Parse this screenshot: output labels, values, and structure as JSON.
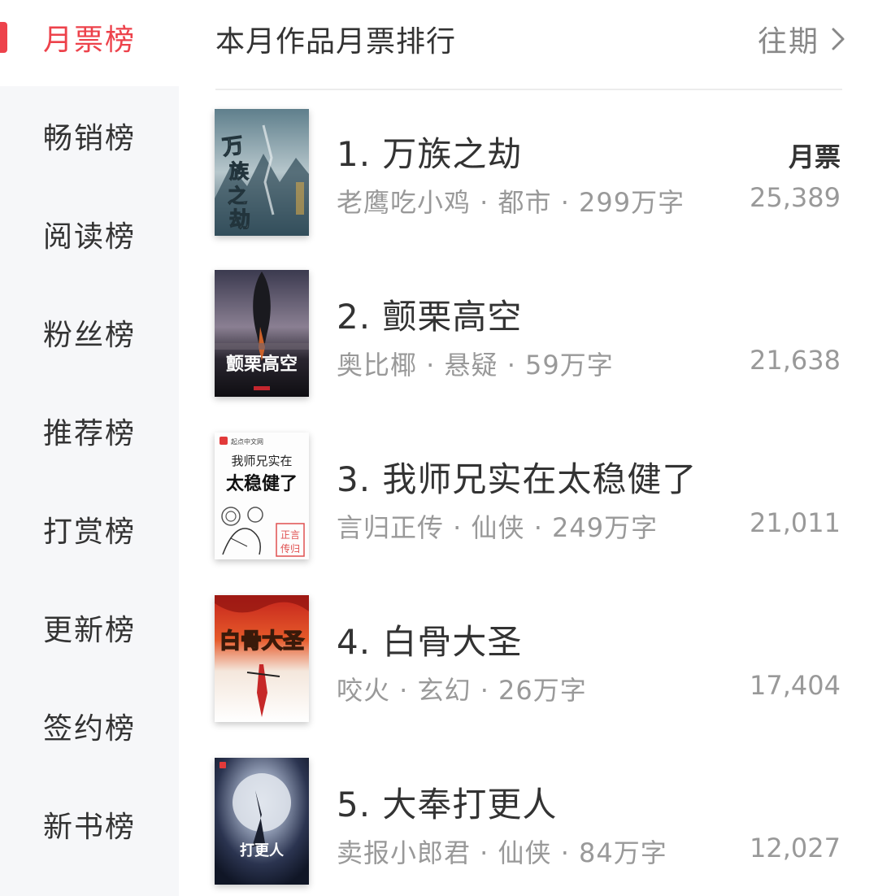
{
  "sidebar": {
    "items": [
      {
        "label": "月票榜",
        "active": true
      },
      {
        "label": "畅销榜"
      },
      {
        "label": "阅读榜"
      },
      {
        "label": "粉丝榜"
      },
      {
        "label": "推荐榜"
      },
      {
        "label": "打赏榜"
      },
      {
        "label": "更新榜"
      },
      {
        "label": "签约榜"
      },
      {
        "label": "新书榜"
      }
    ],
    "accent_color": "#ed424b"
  },
  "header": {
    "title": "本月作品月票排行",
    "history_label": "往期",
    "history_icon": "chevron-right-icon"
  },
  "list": {
    "votes_label": "月票",
    "books": [
      {
        "title": "1. 万族之劫",
        "meta": "老鹰吃小鸡 · 都市 · 299万字",
        "votes": "25,389",
        "cover_text": "万族之劫"
      },
      {
        "title": "2. 颤栗高空",
        "meta": "奥比椰 · 悬疑 · 59万字",
        "votes": "21,638",
        "cover_text": "颤栗高空"
      },
      {
        "title": "3. 我师兄实在太稳健了",
        "meta": "言归正传 · 仙侠 · 249万字",
        "votes": "21,011",
        "cover_text_top": "我师兄实在",
        "cover_text_main": "太稳健了",
        "cover_brand": "起点中文网"
      },
      {
        "title": "4. 白骨大圣",
        "meta": "咬火 · 玄幻 · 26万字",
        "votes": "17,404",
        "cover_text": "白骨大圣"
      },
      {
        "title": "5. 大奉打更人",
        "meta": "卖报小郎君 · 仙侠 · 84万字",
        "votes": "12,027",
        "cover_text": "打更人"
      }
    ]
  }
}
